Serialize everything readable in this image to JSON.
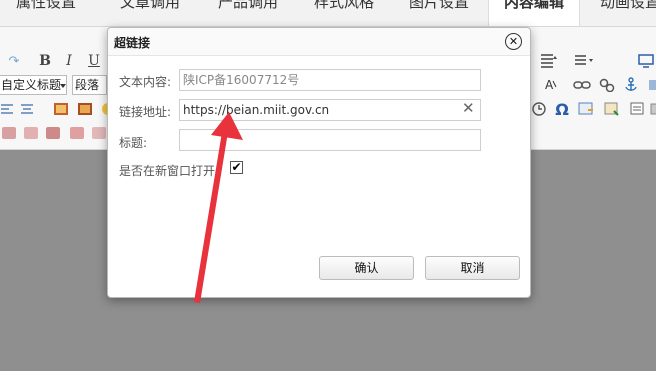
{
  "tabs": [
    {
      "label": "属性设置"
    },
    {
      "label": "文章调用"
    },
    {
      "label": "产品调用"
    },
    {
      "label": "样式风格"
    },
    {
      "label": "图片设置"
    },
    {
      "label": "内容编辑"
    },
    {
      "label": "动画设置"
    }
  ],
  "toolbar": {
    "bold": "B",
    "italic": "I",
    "underline": "U",
    "heading_select": "自定义标题",
    "paragraph_select": "段落",
    "omega": "Ω"
  },
  "dialog": {
    "title": "超链接",
    "close": "✕",
    "text_label": "文本内容:",
    "text_value": "陕ICP备16007712号",
    "url_label": "链接地址:",
    "url_value": "https://beian.miit.gov.cn",
    "clear": "✕",
    "title_label": "标题:",
    "title_value": "",
    "newwin_label": "是否在新窗口打开:",
    "newwin_check": "✔",
    "ok": "确认",
    "cancel": "取消"
  },
  "colors": {
    "annotation_arrow": "#e8323c",
    "backdrop": "#8f8f8f"
  }
}
